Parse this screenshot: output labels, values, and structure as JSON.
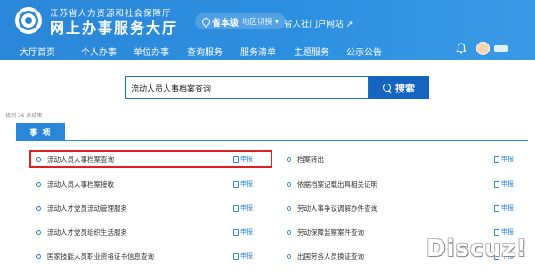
{
  "header": {
    "org_name": "江苏省人力资源和社会保障厅",
    "site_title": "网上办事服务大厅",
    "region": {
      "name": "省本级",
      "switch_label": "地区切换 ▾"
    },
    "portal_link": "省人社门户网站 ↗"
  },
  "nav": {
    "items": [
      {
        "label": "大厅首页"
      },
      {
        "label": "个人办事"
      },
      {
        "label": "单位办事"
      },
      {
        "label": "查询服务"
      },
      {
        "label": "服务清单"
      },
      {
        "label": "主题服务"
      },
      {
        "label": "公示公告"
      }
    ],
    "icons": [
      "bell-icon",
      "avatar"
    ]
  },
  "search": {
    "value": "流动人员人事档案查询",
    "button_label": "搜索",
    "button_icon": "search-icon"
  },
  "result_count": "找到 36 条结果",
  "tab": {
    "label": "事 项"
  },
  "items_left": [
    {
      "label": "流动人员人事档案查询",
      "action": "申报",
      "highlighted": true
    },
    {
      "label": "流动人员人事档案接收",
      "action": "申报"
    },
    {
      "label": "流动人才党员流动管理服务",
      "action": "申报"
    },
    {
      "label": "流动人才党员组织生活服务",
      "action": "申报"
    },
    {
      "label": "国家技能人员职业资格证书信息查询",
      "action": "申报"
    }
  ],
  "items_right": [
    {
      "label": "档案转出",
      "action": "申报"
    },
    {
      "label": "依据档案记载出具相关证明",
      "action": "申报"
    },
    {
      "label": "劳动人事争议调解办件查询",
      "action": "申报"
    },
    {
      "label": "劳动保障监察案件查询",
      "action": "申报"
    },
    {
      "label": "出国劳务人员换证查询",
      "action": "申报"
    }
  ],
  "watermark": "Discuz!",
  "colors": {
    "brand_blue": "#2a86d8",
    "button_blue": "#1565c0",
    "highlight_red": "#e02020"
  }
}
